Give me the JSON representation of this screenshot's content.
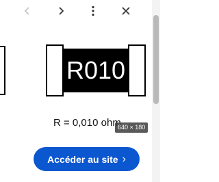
{
  "toolbar": {
    "prev_icon": "chevron-left-icon",
    "next_icon": "chevron-right-icon",
    "more_icon": "more-vert-icon",
    "close_icon": "close-icon"
  },
  "image": {
    "marking": "R010",
    "formula": "R = 0,010 ohm",
    "size_badge": "640 × 180"
  },
  "cta": {
    "label": "Accéder au site",
    "chevron": "›"
  },
  "colors": {
    "cta_bg": "#0b57d0",
    "resistor_body": "#000000"
  }
}
